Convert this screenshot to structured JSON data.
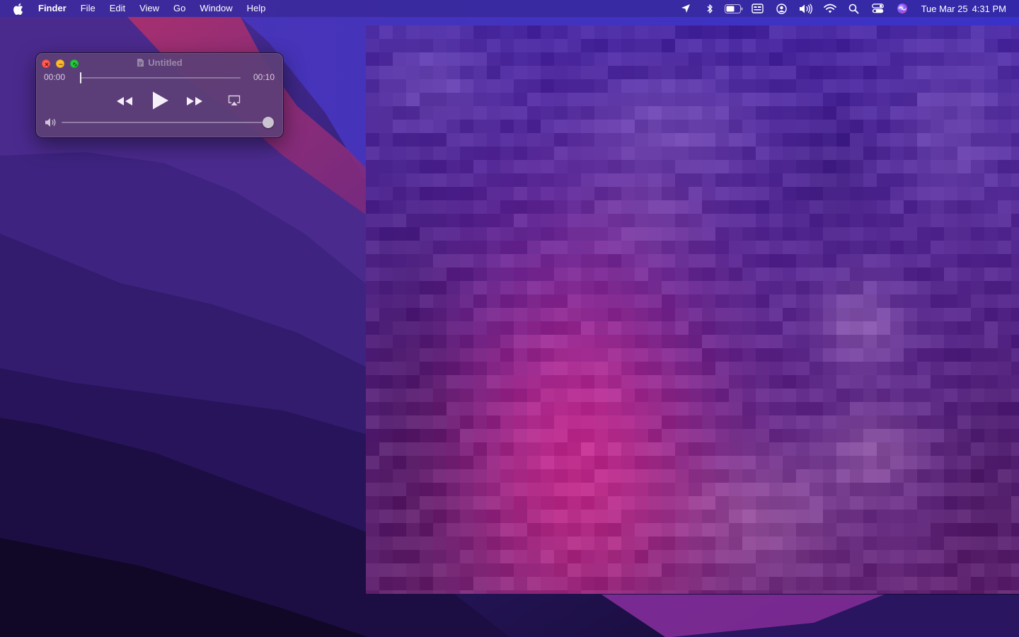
{
  "menubar": {
    "apple_icon": "apple-logo-icon",
    "app_name": "Finder",
    "menus": [
      "File",
      "Edit",
      "View",
      "Go",
      "Window",
      "Help"
    ],
    "status_icons": [
      "location-arrow-icon",
      "bluetooth-icon",
      "battery-icon",
      "display-icon",
      "user-account-icon",
      "volume-icon",
      "wifi-icon",
      "search-icon",
      "control-center-icon",
      "siri-icon"
    ],
    "date": "Tue Mar 25",
    "time": "4:31 PM"
  },
  "player": {
    "title": "Untitled",
    "current_time": "00:00",
    "total_time": "00:10",
    "progress": 0,
    "volume": 1.0,
    "controls": [
      "rewind-icon",
      "play-icon",
      "fast-forward-icon",
      "airplay-icon"
    ]
  },
  "colors": {
    "close": "#ff5f57",
    "minimize": "#febc2e",
    "zoom": "#28c840",
    "panel": "#5c3e76"
  }
}
